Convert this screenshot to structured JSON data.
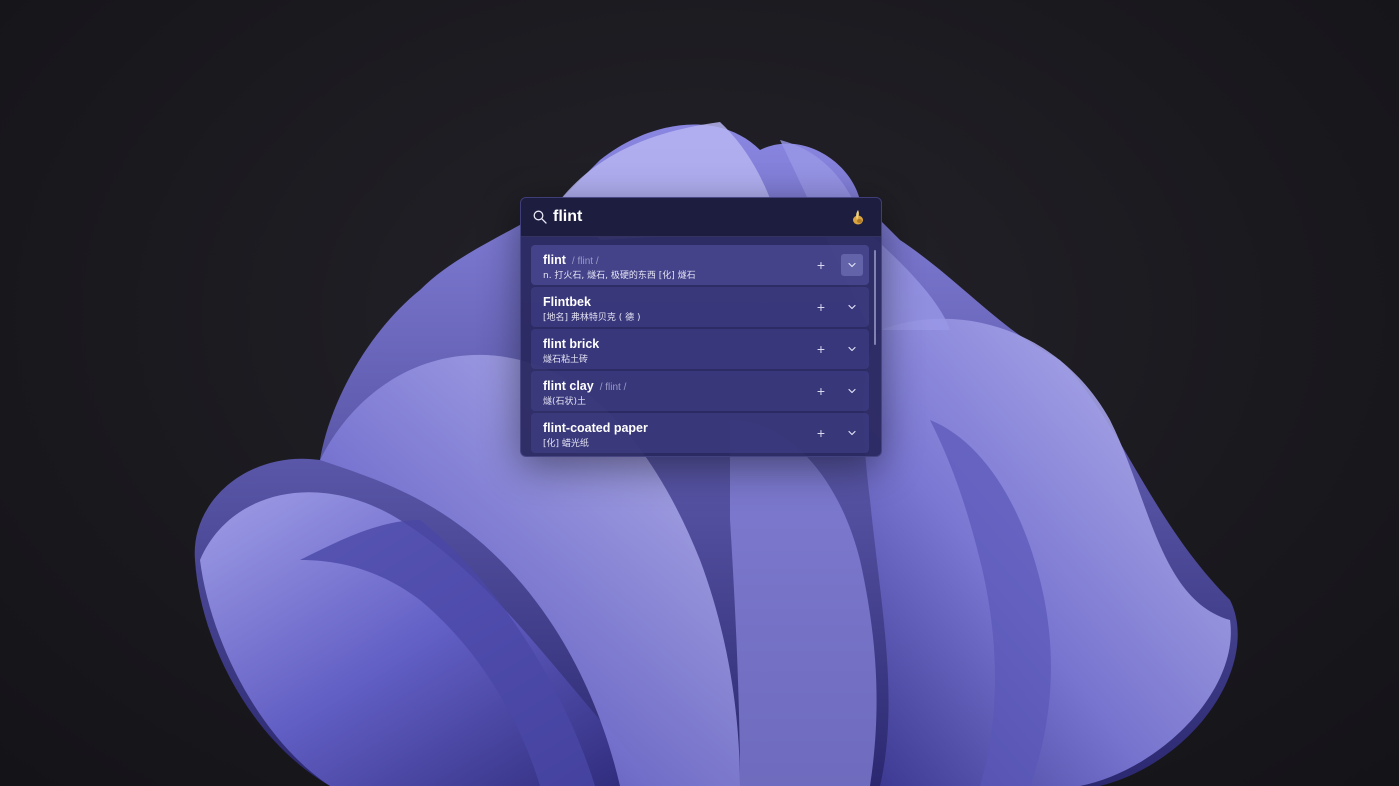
{
  "search": {
    "query": "flint",
    "icon": "search-icon",
    "app_icon": "app-icon"
  },
  "results": [
    {
      "word": "flint",
      "phonetic": "/ flint /",
      "definition": "n. 打火石, 燧石, 极硬的东西   [化] 燧石",
      "active": true
    },
    {
      "word": "Flintbek",
      "phonetic": "",
      "definition": "[地名] 弗林特贝克 ( 德 )",
      "active": false
    },
    {
      "word": "flint brick",
      "phonetic": "",
      "definition": "燧石粘土砖",
      "active": false
    },
    {
      "word": "flint clay",
      "phonetic": "/ flint /",
      "definition": "燧(石状)土",
      "active": false
    },
    {
      "word": "flint-coated paper",
      "phonetic": "",
      "definition": "[化] 蜡光纸",
      "active": false
    }
  ],
  "actions": {
    "add_label": "+",
    "expand_icon": "chevron-down-icon"
  },
  "colors": {
    "popup_bg": "#28265c",
    "accent": "#6d6bd6",
    "text": "#ffffff",
    "phonetic": "#9a99c8"
  }
}
